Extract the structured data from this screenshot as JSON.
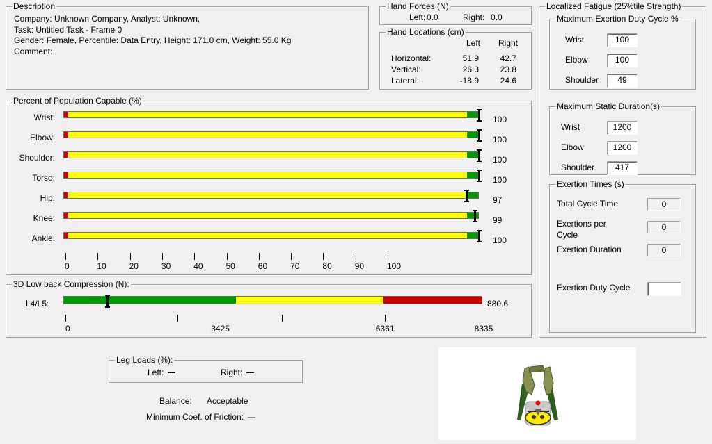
{
  "description": {
    "legend": "Description",
    "line1": "Company: Unknown Company, Analyst: Unknown,",
    "line2": "Task: Untitled Task - Frame 0",
    "line3": "Gender: Female, Percentile: Data Entry, Height: 171.0 cm, Weight: 55.0 Kg",
    "line4": "Comment:"
  },
  "hand_forces": {
    "legend": "Hand Forces (N)",
    "left_label": "Left:",
    "left_value": "0.0",
    "right_label": "Right:",
    "right_value": "0.0"
  },
  "hand_locations": {
    "legend": "Hand Locations (cm)",
    "col_left": "Left",
    "col_right": "Right",
    "rows": [
      {
        "label": "Horizontal:",
        "left": "51.9",
        "right": "42.7"
      },
      {
        "label": "Vertical:",
        "left": "26.3",
        "right": "23.8"
      },
      {
        "label": "Lateral:",
        "left": "-18.9",
        "right": "24.6"
      }
    ]
  },
  "population": {
    "legend": "Percent of Population Capable (%)",
    "rows": [
      {
        "label": "Wrist:",
        "value": 100,
        "value_text": "100"
      },
      {
        "label": "Elbow:",
        "value": 100,
        "value_text": "100"
      },
      {
        "label": "Shoulder:",
        "value": 100,
        "value_text": "100"
      },
      {
        "label": "Torso:",
        "value": 100,
        "value_text": "100"
      },
      {
        "label": "Hip:",
        "value": 97,
        "value_text": "97"
      },
      {
        "label": "Knee:",
        "value": 99,
        "value_text": "99"
      },
      {
        "label": "Ankle:",
        "value": 100,
        "value_text": "100"
      }
    ],
    "zone_red_end": 1,
    "zone_yellow_end": 97,
    "axis_ticks": [
      "0",
      "10",
      "20",
      "30",
      "40",
      "50",
      "60",
      "70",
      "80",
      "90",
      "100"
    ],
    "colors": {
      "red": "#cc0000",
      "yellow": "#ffff00",
      "green": "#009900"
    }
  },
  "compression": {
    "legend": "3D Low back Compression (N):",
    "label": "L4/L5:",
    "value": 880.6,
    "value_text": "880.6",
    "axis_max": 8335,
    "zones": [
      3425,
      6361,
      8335
    ],
    "axis_labels": [
      "0",
      "3425",
      "6361",
      "8335"
    ],
    "colors": {
      "green": "#009900",
      "yellow": "#ffff00",
      "red": "#cc0000"
    }
  },
  "fatigue": {
    "legend": "Localized Fatigue (25%tile Strength)",
    "duty": {
      "legend": "Maximum Exertion Duty Cycle %",
      "rows": [
        {
          "label": "Wrist",
          "value": "100"
        },
        {
          "label": "Elbow",
          "value": "100"
        },
        {
          "label": "Shoulder",
          "value": "49"
        }
      ]
    },
    "static": {
      "legend": "Maximum Static Duration(s)",
      "rows": [
        {
          "label": "Wrist",
          "value": "1200"
        },
        {
          "label": "Elbow",
          "value": "1200"
        },
        {
          "label": "Shoulder",
          "value": "417"
        }
      ]
    },
    "exertion": {
      "legend": "Exertion Times (s)",
      "total_label": "Total Cycle Time",
      "total_value": "0",
      "per_label_1": "Exertions per",
      "per_label_2": "Cycle",
      "per_value": "0",
      "duration_label": "Exertion Duration",
      "duration_value": "0",
      "duty_label": "Exertion Duty Cycle",
      "duty_value": ""
    }
  },
  "leg_loads": {
    "legend": "Leg Loads (%):",
    "left_label": "Left:",
    "right_label": "Right:"
  },
  "balance": {
    "label": "Balance:",
    "value": "Acceptable"
  },
  "friction": {
    "label": "Minimum Coef. of Friction:"
  }
}
